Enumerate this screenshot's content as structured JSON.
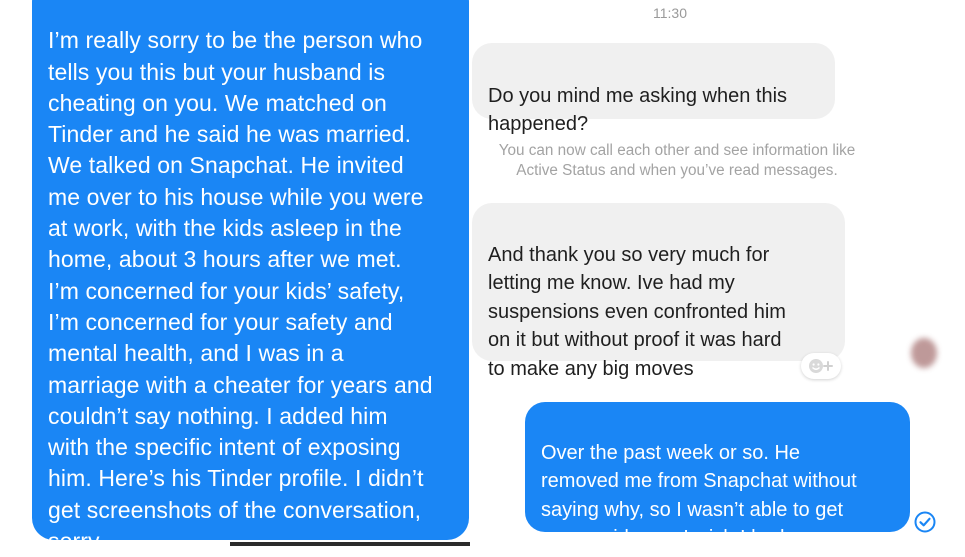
{
  "left_message": {
    "text": "I’m really sorry to be the person who\ntells you this but your husband is\ncheating on you. We matched on\nTinder and he said he was married.\nWe talked on Snapchat. He invited\nme over to his house while you were\nat work, with the kids asleep in the\nhome, about 3 hours after we met.\nI’m concerned for your kids’ safety,\nI’m concerned for your safety and\nmental health, and I was in a\nmarriage with a cheater for years and\ncouldn’t say nothing. I added him\nwith the specific intent of exposing\nhim. Here’s his Tinder profile. I didn’t\nget screenshots of the conversation,\nsorry."
  },
  "chat": {
    "timestamp": "11:30",
    "incoming_1": "Do you mind me asking when this\nhappened?",
    "system_note": "You can now call each other and see information like\nActive Status and when you’ve read messages.",
    "incoming_2": "And thank you so very much for\nletting me know. Ive had my\nsuspensions  even confronted him\non it but without proof it was hard\nto make any big moves",
    "outgoing_1": "Over the past week or so. He\nremoved me from Snapchat without\nsaying why, so I wasn’t able to get\nmore evidence. I wish I had."
  },
  "icons": {
    "reaction": "add-reaction-icon",
    "seen": "seen-check-icon"
  },
  "colors": {
    "outgoing_bubble": "#1a86f5",
    "incoming_bubble": "#f0f0f0",
    "muted_text": "#a3a3a3"
  }
}
